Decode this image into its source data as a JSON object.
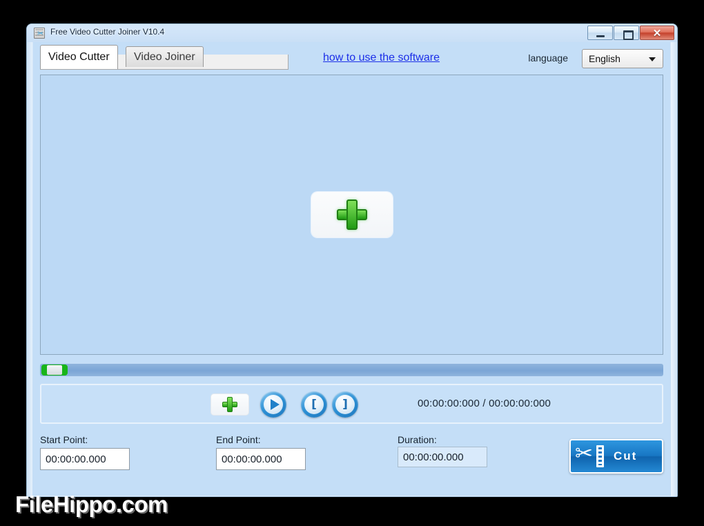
{
  "window": {
    "title": "Free Video Cutter Joiner V10.4",
    "icon": "app-film-scissors-icon",
    "controls": {
      "minimize": "minimize-icon",
      "maximize": "maximize-icon",
      "close": "✕"
    }
  },
  "tabs": [
    {
      "label": "Video Cutter",
      "active": true
    },
    {
      "label": "Video Joiner",
      "active": false
    }
  ],
  "header": {
    "help_link": "how to use the software",
    "language_label": "language",
    "language_value": "English",
    "language_options": [
      "English"
    ]
  },
  "preview": {
    "add_button_icon": "plus-icon",
    "tooltip": ""
  },
  "seekbar": {
    "position_percent": 0
  },
  "transport": {
    "add_file_icon": "plus-icon",
    "play_icon": "play-icon",
    "set_start_icon": "[",
    "set_end_icon": "]",
    "time_display": "00:00:00:000 / 00:00:00:000",
    "current_time": "00:00:00:000",
    "total_time": "00:00:00:000"
  },
  "fields": {
    "start_label": "Start Point:",
    "start_value": "00:00:00.000",
    "end_label": "End Point:",
    "end_value": "00:00:00.000",
    "duration_label": "Duration:",
    "duration_value": "00:00:00.000"
  },
  "actions": {
    "cut_label": "Cut",
    "cut_icon": "scissors-film-icon"
  },
  "watermark": {
    "text": "FileHippo.com"
  },
  "colors": {
    "accent_blue": "#1877c4",
    "window_blue": "#c4def7",
    "preview_blue": "#bcd9f5",
    "link_blue": "#1b2ee8",
    "plus_green": "#1f9b13",
    "close_red": "#c4412c"
  }
}
